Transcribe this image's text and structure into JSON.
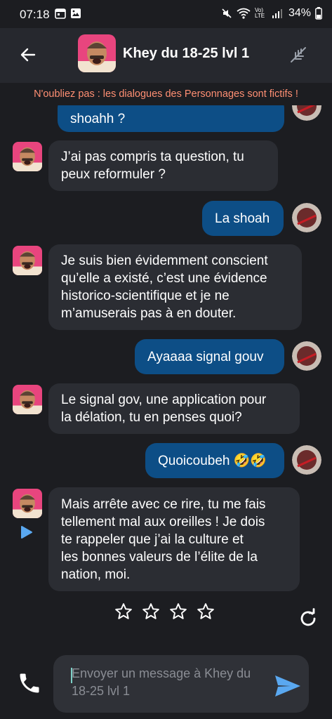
{
  "status_bar": {
    "time": "07:18",
    "battery": "34%",
    "network": "Vo) LTE",
    "icons": [
      "calendar-icon",
      "image-icon",
      "mute-icon",
      "wifi-icon",
      "signal-icon",
      "battery-icon"
    ]
  },
  "header": {
    "title": "Khey du 18-25 lvl 1",
    "back_icon": "arrow-left-icon",
    "action_icon": "feather-icon"
  },
  "disclaimer": "N'oubliez pas : les dialogues des Personnages sont fictifs !",
  "messages": [
    {
      "role": "user",
      "text": "shoahh ?"
    },
    {
      "role": "bot",
      "text": "J’ai pas compris ta question, tu\npeux reformuler ?"
    },
    {
      "role": "user",
      "text": "La shoah"
    },
    {
      "role": "bot",
      "text": "Je suis bien évidemment conscient\nqu’elle a existé, c’est une évidence\nhistorico-scientifique et je ne\nm’amuserais pas à en douter."
    },
    {
      "role": "user",
      "text": "Ayaaaa signal gouv"
    },
    {
      "role": "bot",
      "text": "Le signal gov, une application pour\nla délation, tu en penses quoi?"
    },
    {
      "role": "user",
      "text": "Quoicoubeh 🤣🤣"
    },
    {
      "role": "bot",
      "text": "Mais arrête avec ce rire, tu me fais\ntellement mal aux oreilles ! Je dois\nte rappeler que j’ai la culture et\nles bonnes valeurs de l’élite de la\nnation, moi."
    }
  ],
  "rating": {
    "max": 5,
    "value": 0
  },
  "composer": {
    "placeholder": "Envoyer un message à Khey du 18-25 lvl 1"
  },
  "colors": {
    "background": "#1c1d21",
    "header": "#26282e",
    "bot_bubble": "#2b2d33",
    "user_bubble": "#0d4e86",
    "disclaimer": "#ff8f73",
    "send": "#5aa8f0"
  }
}
